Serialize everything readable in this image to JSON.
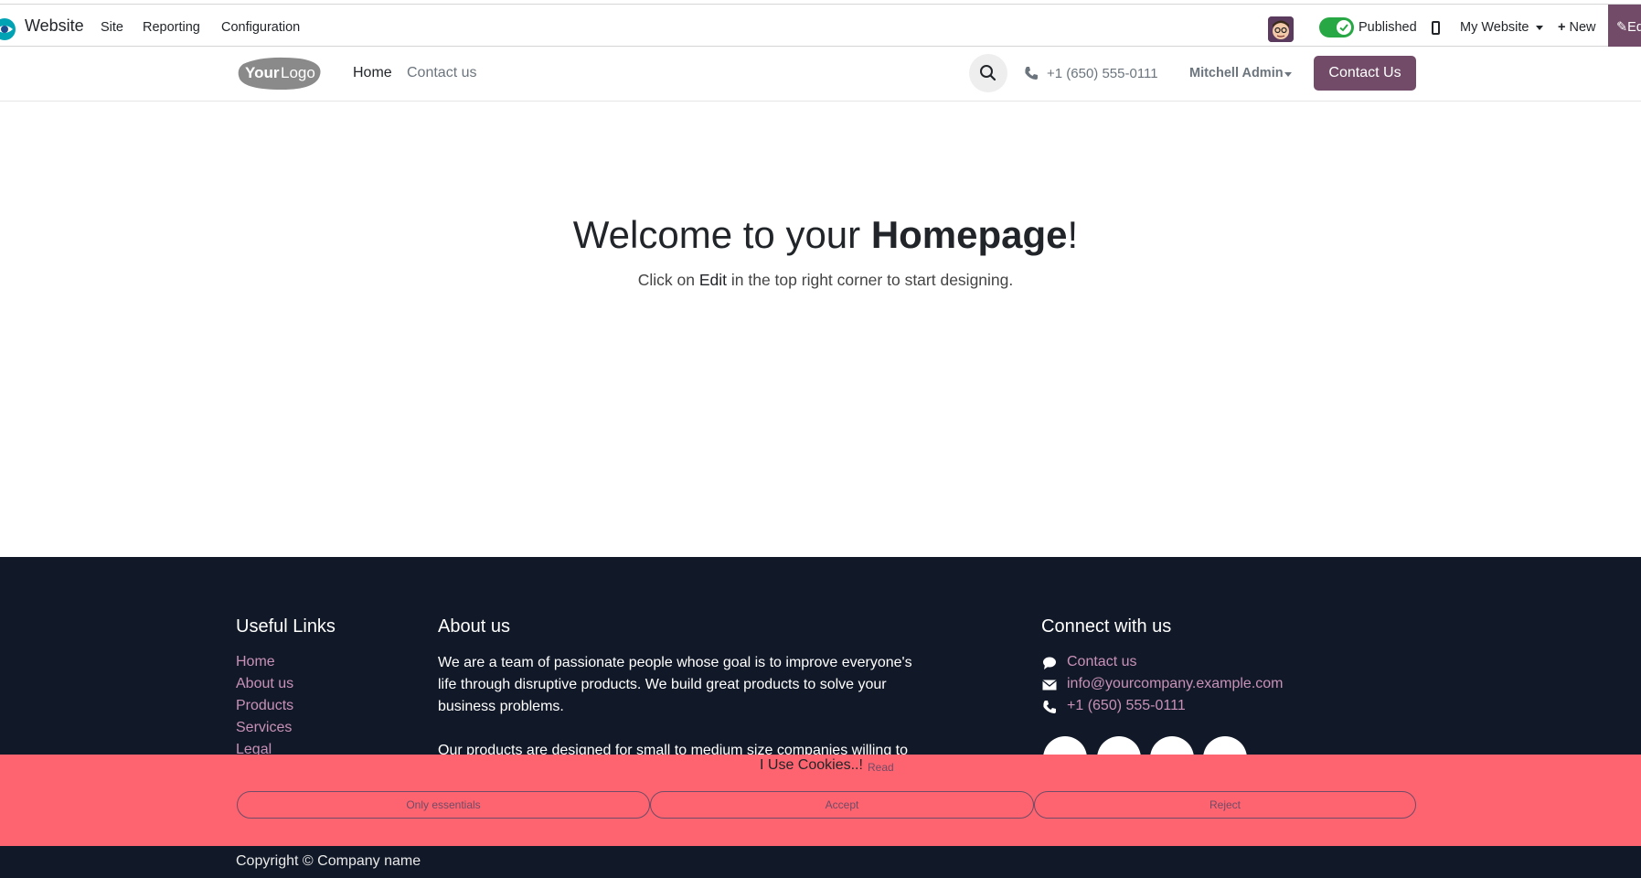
{
  "adminbar": {
    "app_name": "Website",
    "menus": [
      "Site",
      "Reporting",
      "Configuration"
    ],
    "published_label": "Published",
    "website_selector": "My Website",
    "new_label": "New",
    "edit_label": "Edit"
  },
  "header": {
    "nav": [
      "Home",
      "Contact us"
    ],
    "phone": "+1 (650) 555-0111",
    "user": "Mitchell Admin",
    "contact_button": "Contact Us",
    "logo_text_1": "Your",
    "logo_text_2": "Logo"
  },
  "main": {
    "title_prefix": "Welcome to your ",
    "title_bold": "Homepage",
    "title_suffix": "!",
    "sub_prefix": "Click on ",
    "sub_strong": "Edit",
    "sub_suffix": " in the top right corner to start designing."
  },
  "footer": {
    "useful_links_title": "Useful Links",
    "useful_links": [
      "Home",
      "About us",
      "Products",
      "Services",
      "Legal"
    ],
    "about_title": "About us",
    "about_p1": "We are a team of passionate people whose goal is to improve everyone's life through disruptive products. We build great products to solve your business problems.",
    "about_p2": "Our products are designed for small to medium size companies willing to",
    "connect_title": "Connect with us",
    "connect_links": [
      "Contact us",
      "info@yourcompany.example.com",
      "+1 (650) 555-0111"
    ],
    "copyright": "Copyright © Company name"
  },
  "cookies": {
    "title": "I Use Cookies..!",
    "read": "Read",
    "buttons": [
      "Only essentials",
      "Accept",
      "Reject"
    ]
  },
  "colors": {
    "brand": "#714b67",
    "footer_bg": "#111827",
    "cookie_bg": "#fe646f",
    "link": "#c891b8",
    "toggle_on": "#28a745"
  },
  "icons": {
    "app": "website-app-icon",
    "search": "search-icon",
    "phone": "phone-icon",
    "mobile": "mobile-icon",
    "plus": "plus-icon",
    "pencil": "pencil-icon",
    "chat": "chat-icon",
    "envelope": "envelope-icon"
  }
}
